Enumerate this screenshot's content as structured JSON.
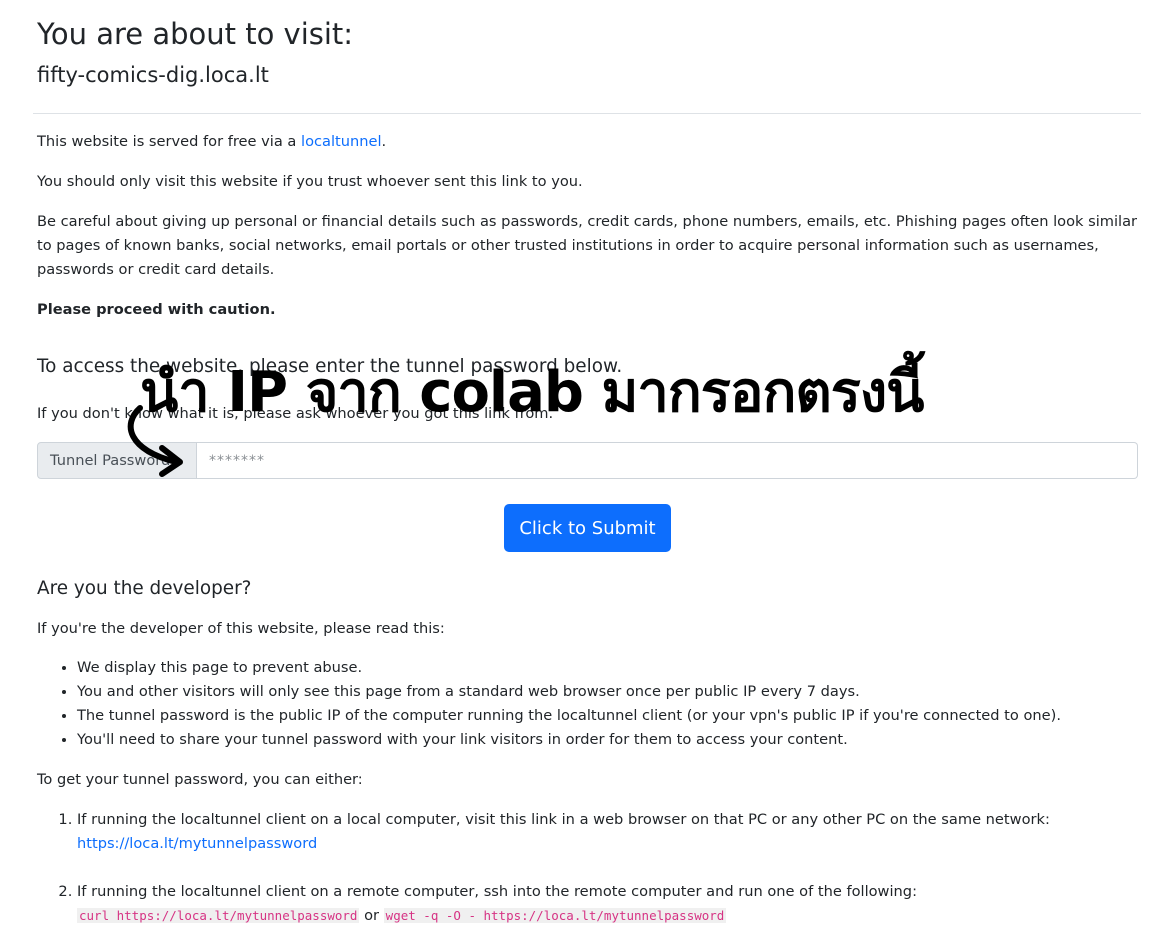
{
  "header": {
    "title": "You are about to visit:",
    "host": "fifty-comics-dig.loca.lt"
  },
  "intro": {
    "served_prefix": "This website is served for free via a ",
    "served_link": "localtunnel",
    "served_suffix": ".",
    "trust": "You should only visit this website if you trust whoever sent this link to you.",
    "careful": "Be careful about giving up personal or financial details such as passwords, credit cards, phone numbers, emails, etc. Phishing pages often look similar to pages of known banks, social networks, email portals or other trusted institutions in order to acquire personal information such as usernames, passwords or credit card details.",
    "caution": "Please proceed with caution."
  },
  "access": {
    "heading": "To access the website, please enter the tunnel password below.",
    "hint": "If you don't know what it is, please ask whoever you got this link from.",
    "addon_label": "Tunnel Password:",
    "placeholder": "*******",
    "submit_label": "Click to Submit"
  },
  "developer": {
    "heading": "Are you the developer?",
    "intro": "If you're the developer of this website, please read this:",
    "bullets": [
      "We display this page to prevent abuse.",
      "You and other visitors will only see this page from a standard web browser once per public IP every 7 days.",
      "The tunnel password is the public IP of the computer running the localtunnel client (or your vpn's public IP if you're connected to one).",
      "You'll need to share your tunnel password with your link visitors in order for them to access your content."
    ],
    "get_password": "To get your tunnel password, you can either:",
    "step1_text": "If running the localtunnel client on a local computer, visit this link in a web browser on that PC or any other PC on the same network:",
    "step1_link": "https://loca.lt/mytunnelpassword",
    "step2_text": "If running the localtunnel client on a remote computer, ssh into the remote computer and run one of the following:",
    "step2_cmd1": "curl https://loca.lt/mytunnelpassword",
    "step2_or": " or ",
    "step2_cmd2": "wget -q -O - https://loca.lt/mytunnelpassword"
  },
  "annotation": {
    "text": "นำ IP จาก colab มากรอกตรงนี้",
    "arrow_icon": "curved-arrow-icon"
  }
}
